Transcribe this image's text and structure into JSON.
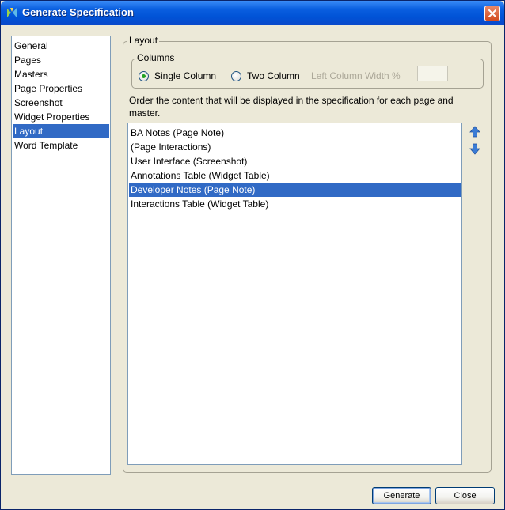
{
  "window": {
    "title": "Generate Specification",
    "app_icon": "axure-logo-icon",
    "close_icon": "close-icon"
  },
  "nav": {
    "items": [
      {
        "label": "General",
        "selected": false
      },
      {
        "label": "Pages",
        "selected": false
      },
      {
        "label": "Masters",
        "selected": false
      },
      {
        "label": "Page Properties",
        "selected": false
      },
      {
        "label": "Screenshot",
        "selected": false
      },
      {
        "label": "Widget Properties",
        "selected": false
      },
      {
        "label": "Layout",
        "selected": true
      },
      {
        "label": "Word Template",
        "selected": false
      }
    ]
  },
  "layout": {
    "group_title": "Layout",
    "columns": {
      "group_title": "Columns",
      "single_label": "Single Column",
      "single_checked": true,
      "two_label": "Two Column",
      "two_checked": false,
      "width_label": "Left Column Width %",
      "width_value": ""
    },
    "description": "Order the content that will be displayed in the specification for each page and master.",
    "content_list": [
      {
        "label": "BA Notes (Page Note)",
        "selected": false
      },
      {
        "label": "(Page Interactions)",
        "selected": false
      },
      {
        "label": "User Interface (Screenshot)",
        "selected": false
      },
      {
        "label": "Annotations Table (Widget Table)",
        "selected": false
      },
      {
        "label": "Developer Notes (Page Note)",
        "selected": true
      },
      {
        "label": "Interactions Table (Widget Table)",
        "selected": false
      }
    ],
    "move_up_icon": "arrow-up-icon",
    "move_down_icon": "arrow-down-icon"
  },
  "buttons": {
    "generate": "Generate",
    "close": "Close"
  },
  "colors": {
    "selection": "#316AC5",
    "titlebar": "#0052D6",
    "dialog_bg": "#ECE9D8",
    "arrow": "#3A7BD5"
  }
}
